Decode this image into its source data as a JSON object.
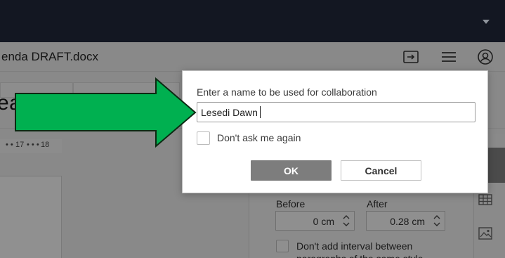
{
  "document": {
    "title": "enda DRAFT.docx",
    "heading_fragment": "ea"
  },
  "ruler": {
    "marks": [
      "17",
      "18"
    ]
  },
  "paragraph_panel": {
    "before_label": "Before",
    "after_label": "After",
    "before_value": "0 cm",
    "after_value": "0.28 cm",
    "no_interval_line1": "Don't add interval between",
    "no_interval_line2": "paragraphs of the same style"
  },
  "dialog": {
    "prompt": "Enter a name to be used for collaboration",
    "name_value": "Lesedi Dawn",
    "dont_ask_label": "Don't ask me again",
    "dont_ask_checked": false,
    "ok_label": "OK",
    "cancel_label": "Cancel"
  },
  "icons": {
    "titlebar": [
      "open-file-location-icon",
      "menu-icon",
      "user-icon"
    ],
    "rail": [
      "table-icon",
      "image-icon"
    ],
    "annotation": "green-arrow-icon"
  },
  "colors": {
    "topbar": "#131722",
    "overlay_dim": "#898989",
    "arrow_fill": "#00b050",
    "ok_button": "#7d7d7d"
  }
}
